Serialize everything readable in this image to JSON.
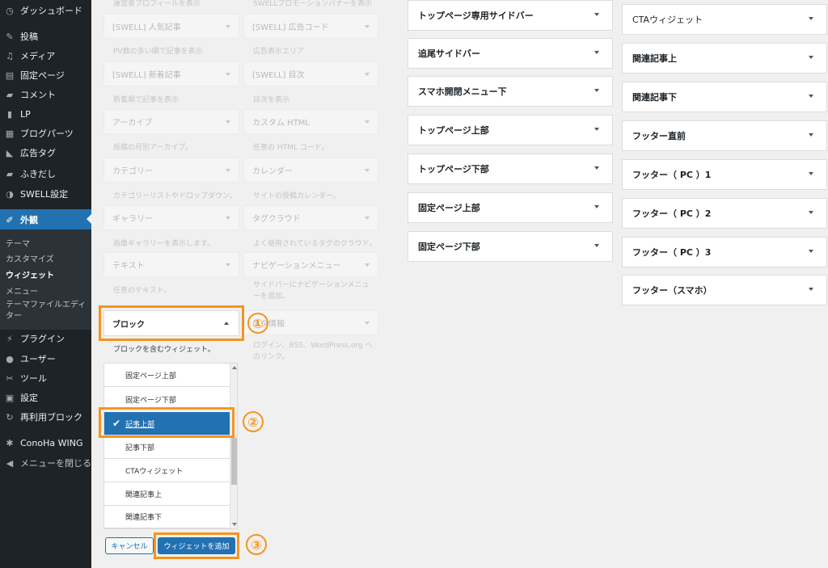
{
  "sidebar": {
    "items": [
      {
        "label": "ダッシュボード",
        "icon": "dashboard-icon",
        "glyph": "◷"
      },
      {
        "label": "投稿",
        "icon": "pin-icon",
        "glyph": "✎"
      },
      {
        "label": "メディア",
        "icon": "media-icon",
        "glyph": "♫"
      },
      {
        "label": "固定ページ",
        "icon": "page-icon",
        "glyph": "▤"
      },
      {
        "label": "コメント",
        "icon": "comment-icon",
        "glyph": "▰"
      },
      {
        "label": "LP",
        "icon": "document-icon",
        "glyph": "▮"
      },
      {
        "label": "ブログパーツ",
        "icon": "grid-icon",
        "glyph": "▦"
      },
      {
        "label": "広告タグ",
        "icon": "megaphone-icon",
        "glyph": "◣"
      },
      {
        "label": "ふきだし",
        "icon": "speech-bubble-icon",
        "glyph": "▰"
      },
      {
        "label": "SWELL設定",
        "icon": "swell-icon",
        "glyph": "◑"
      },
      {
        "label": "外観",
        "icon": "brush-icon",
        "glyph": "✐"
      },
      {
        "label": "プラグイン",
        "icon": "plugin-icon",
        "glyph": "⚡"
      },
      {
        "label": "ユーザー",
        "icon": "user-icon",
        "glyph": "●"
      },
      {
        "label": "ツール",
        "icon": "wrench-icon",
        "glyph": "✂"
      },
      {
        "label": "設定",
        "icon": "settings-icon",
        "glyph": "▣"
      },
      {
        "label": "再利用ブロック",
        "icon": "reuse-icon",
        "glyph": "↻"
      },
      {
        "label": "ConoHa WING",
        "icon": "gear-icon",
        "glyph": "✱"
      },
      {
        "label": "メニューを閉じる",
        "icon": "collapse-icon",
        "glyph": "◀"
      }
    ],
    "submenu": [
      "テーマ",
      "カスタマイズ",
      "ウィジェット",
      "メニュー",
      "テーマファイルエディター"
    ]
  },
  "available": {
    "desc_top_left": "運営者プロフィールを表示",
    "desc_top_right": "SWELLプロモーションバナーを表示",
    "widgets": [
      {
        "label": "[SWELL] 人気記事",
        "desc": "PV数の多い順で記事を表示"
      },
      {
        "label": "[SWELL] 広告コード",
        "desc": "広告表示エリア"
      },
      {
        "label": "[SWELL] 新着記事",
        "desc": "新着順で記事を表示"
      },
      {
        "label": "[SWELL] 目次",
        "desc": "目次を表示"
      },
      {
        "label": "アーカイブ",
        "desc": "投稿の月別アーカイブ。"
      },
      {
        "label": "カスタム HTML",
        "desc": "任意の HTML コード。"
      },
      {
        "label": "カテゴリー",
        "desc": "カテゴリーリストやドロップダウン。"
      },
      {
        "label": "カレンダー",
        "desc": "サイトの投稿カレンダー。"
      },
      {
        "label": "ギャラリー",
        "desc": "画像ギャラリーを表示します。"
      },
      {
        "label": "タグクラウド",
        "desc": "よく使用されているタグのクラウド。"
      },
      {
        "label": "テキスト",
        "desc": "任意のテキスト。"
      },
      {
        "label": "ナビゲーションメニュー",
        "desc": "サイドバーにナビゲーションメニューを追加。"
      },
      {
        "label": "メタ情報",
        "desc": "ログイン、RSS、WordPress.org へのリンク。"
      }
    ],
    "block": {
      "label": "ブロック",
      "desc": "ブロックを含むウィジェット。"
    }
  },
  "chooser": {
    "items": [
      "固定ページ上部",
      "固定ページ下部",
      "記事上部",
      "記事下部",
      "CTAウィジェット",
      "関連記事上",
      "関連記事下"
    ],
    "selected": "記事上部"
  },
  "buttons": {
    "cancel": "キャンセル",
    "add": "ウィジェットを追加"
  },
  "annotations": [
    "①",
    "②",
    "③"
  ],
  "areas_col1": [
    "トップページ専用サイドバー",
    "追尾サイドバー",
    "スマホ開閉メニュー下",
    "トップページ上部",
    "トップページ下部",
    "固定ページ上部",
    "固定ページ下部"
  ],
  "areas_col2": [
    "CTAウィジェット",
    "関連記事上",
    "関連記事下",
    "フッター直前",
    "フッター（ PC ）1",
    "フッター（ PC ）2",
    "フッター（ PC ）3",
    "フッター（スマホ）"
  ],
  "colors": {
    "accent": "#2271b1",
    "annotation": "#f7941d",
    "admin_bg": "#1e2327"
  }
}
